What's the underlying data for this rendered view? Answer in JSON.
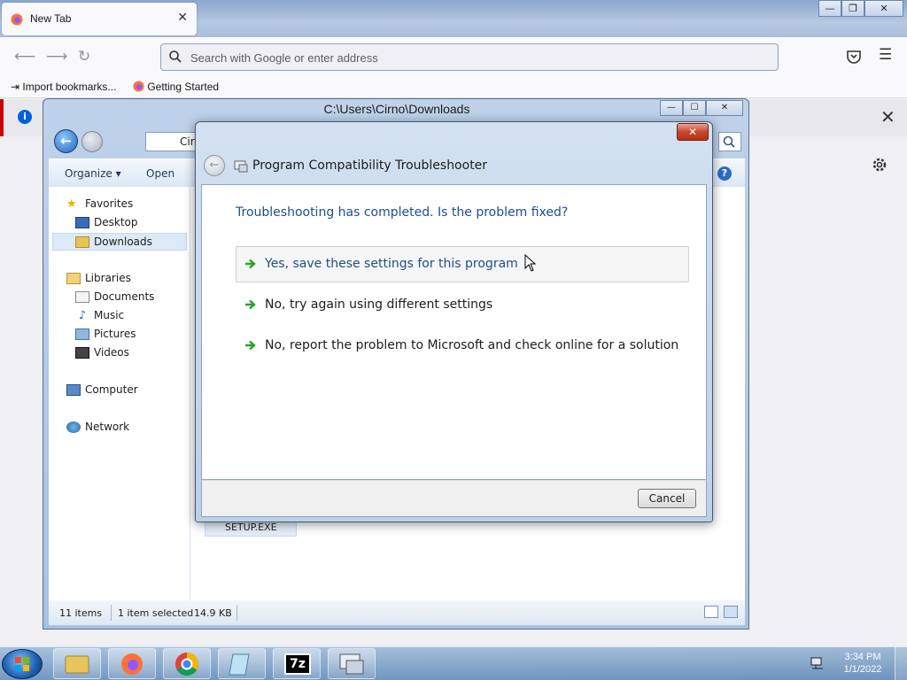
{
  "firefox": {
    "tab_title": "New Tab",
    "tab_close": "✕",
    "url_placeholder": "Search with Google or enter address",
    "bookmarks": [
      "Import bookmarks...",
      "Getting Started"
    ],
    "notice_close": "✕",
    "window_controls": [
      "—",
      "❐",
      "✕"
    ]
  },
  "explorer": {
    "title": "C:\\Users\\Cirno\\Downloads",
    "address_crumb": "Cir",
    "toolbar": [
      "Organize ▾",
      "Open"
    ],
    "help": "?",
    "nav": {
      "favorites": "Favorites",
      "desktop": "Desktop",
      "downloads": "Downloads",
      "libraries": "Libraries",
      "documents": "Documents",
      "music": "Music",
      "pictures": "Pictures",
      "videos": "Videos",
      "computer": "Computer",
      "network": "Network"
    },
    "file_tile": "SETUP.EXE",
    "status": {
      "items": "11 items",
      "selected": "1 item selected",
      "size": "14.9 KB"
    }
  },
  "dialog": {
    "close": "✕",
    "title": "Program Compatibility Troubleshooter",
    "question": "Troubleshooting has completed.  Is the problem fixed?",
    "options": [
      "Yes, save these settings for this program",
      "No, try again using different settings",
      "No, report the problem to Microsoft and check online for a solution"
    ],
    "cancel": "Cancel"
  },
  "taskbar": {
    "time": "3:34 PM",
    "date": "1/1/2022",
    "sevenzip_label": "7z"
  },
  "colors": {
    "dialog_link": "#1e4e8c",
    "arrow_green": "#27a327",
    "close_red": "#c8452c"
  }
}
